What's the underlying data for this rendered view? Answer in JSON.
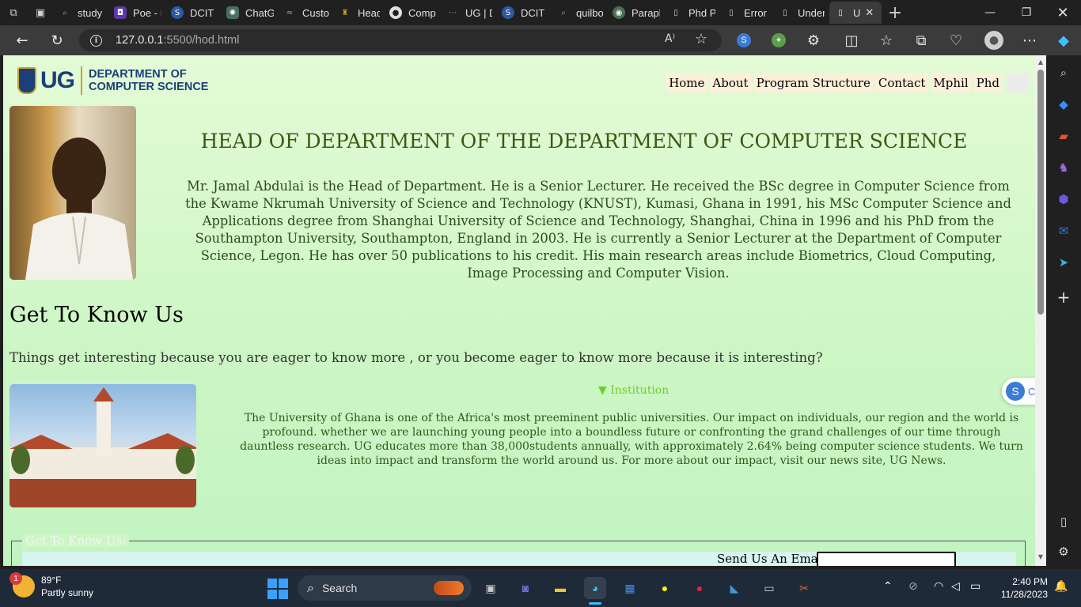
{
  "browser": {
    "tabs": [
      {
        "label": "study",
        "icon": "search-icon"
      },
      {
        "label": "Poe - I",
        "icon": "poe-icon"
      },
      {
        "label": "DCIT 2",
        "icon": "s-icon"
      },
      {
        "label": "ChatG",
        "icon": "chatgpt-icon"
      },
      {
        "label": "Custor",
        "icon": "custom-icon"
      },
      {
        "label": "Head",
        "icon": "ug-crest-icon"
      },
      {
        "label": "Comp",
        "icon": "github-icon"
      },
      {
        "label": "UG | D",
        "icon": "dots-icon"
      },
      {
        "label": "DCIT 2",
        "icon": "s-icon"
      },
      {
        "label": "quilbo",
        "icon": "search-icon"
      },
      {
        "label": "Paraph",
        "icon": "paraphrase-icon"
      },
      {
        "label": "Phd P",
        "icon": "page-icon"
      },
      {
        "label": "Error",
        "icon": "page-icon"
      },
      {
        "label": "Under",
        "icon": "page-icon"
      },
      {
        "label": "U",
        "icon": "page-icon"
      }
    ],
    "url_host": "127.0.0.1",
    "url_path": ":5500/hod.html"
  },
  "page": {
    "logo": {
      "ug": "UG",
      "line1": "DEPARTMENT OF",
      "line2": "COMPUTER SCIENCE"
    },
    "nav": [
      "Home",
      "About",
      "Program Structure",
      "Contact",
      "Mphil",
      "Phd"
    ],
    "hod_title": "HEAD OF DEPARTMENT OF THE DEPARTMENT OF COMPUTER SCIENCE",
    "hod_bio": "Mr. Jamal Abdulai is the Head of Department. He is a Senior Lecturer. He received the BSc degree in Computer Science from the Kwame Nkrumah University of Science and Technology (KNUST), Kumasi, Ghana in 1991, his MSc Computer Science and Applications degree from Shanghai University of Science and Technology, Shanghai, China in 1996 and his PhD from the Southampton University, Southampton, England in 2003. He is currently a Senior Lecturer at the Department of Computer Science, Legon. He has over 50 publications to his credit. His main research areas include Biometrics, Cloud Computing, Image Processing and Computer Vision.",
    "gtk_title": "Get To Know Us",
    "gtk_sub": "Things get interesting because you are eager to know more , or you become eager to know more because it is interesting?",
    "institution_summary": "▼ Institution",
    "institution_text": "The University of Ghana is one of the Africa's most preeminent public universities. Our impact on individuals, our region and the world is profound. whether we are launching young people into a boundless future or confronting the grand challenges of our time through dauntless research. UG educates more than 38,000students annually, with approximately 2.64% being computer science students. We turn ideas into impact and transform the world around us. For more about our impact, visit our news site, UG News.",
    "legend": "Get To Know Us:",
    "email_label": "Send Us An Email:",
    "floater_letter": "S",
    "floater_partial": "C"
  },
  "taskbar": {
    "weather_temp": "89°F",
    "weather_desc": "Partly sunny",
    "weather_badge": "1",
    "search_label": "Search",
    "time": "2:40 PM",
    "date": "11/28/2023"
  },
  "colors": {
    "page_bg": "#d6f8cc",
    "title_green": "#3a5a12",
    "ug_blue": "#1c3f7a",
    "nav_bg": "#fdf0da",
    "summary_green": "#6fcf2a"
  }
}
